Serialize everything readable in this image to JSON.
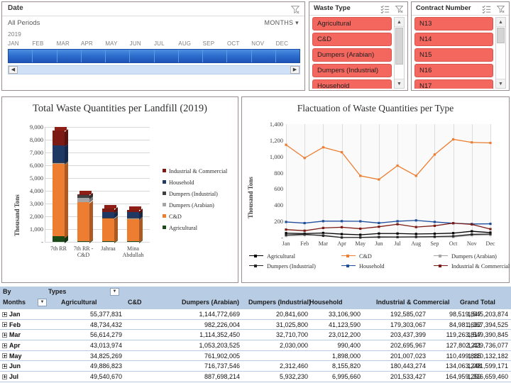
{
  "date_slicer": {
    "title": "Date",
    "period_label": "All Periods",
    "level": "MONTHS",
    "year": "2019",
    "months": [
      "JAN",
      "FEB",
      "MAR",
      "APR",
      "MAY",
      "JUN",
      "JUL",
      "AUG",
      "SEP",
      "OCT",
      "NOV",
      "DEC"
    ],
    "clear_filter_icon": "clear-filter-icon",
    "selection_color": "#2f6fcf"
  },
  "waste_type_slicer": {
    "title": "Waste Type",
    "multi_select_icon": "multi-select-icon",
    "clear_filter_icon": "clear-filter-icon",
    "selected_color": "#f4675f",
    "items": [
      "Agricultural",
      "C&D",
      "Dumpers (Arabian)",
      "Dumpers (Industrial)",
      "Household"
    ]
  },
  "contract_number_slicer": {
    "title": "Contract Number",
    "multi_select_icon": "multi-select-icon",
    "clear_filter_icon": "clear-filter-icon",
    "selected_color": "#f4675f",
    "items": [
      "N13",
      "N14",
      "N15",
      "N16",
      "N17"
    ]
  },
  "chart_data": [
    {
      "type": "bar",
      "id": "bar",
      "title": "Total Waste Quantities per Landfill (2019)",
      "xlabel": "",
      "ylabel": "Thousand Tons",
      "ylim": [
        0,
        9000
      ],
      "yticks": [
        "-",
        "1,000",
        "2,000",
        "3,000",
        "4,000",
        "5,000",
        "6,000",
        "7,000",
        "8,000",
        "9,000"
      ],
      "grid": true,
      "stacked": true,
      "legend_position": "right",
      "categories": [
        "7th RR",
        "7th RR - C&D",
        "Jahraa",
        "Mina Abdullah"
      ],
      "series": [
        {
          "name": "Agricultural",
          "color": "#1b4a18",
          "values": [
            430,
            40,
            45,
            40
          ]
        },
        {
          "name": "C&D",
          "color": "#ed7d31",
          "values": [
            5700,
            3080,
            1820,
            1800
          ]
        },
        {
          "name": "Dumpers (Arabian)",
          "color": "#a5a5a5",
          "values": [
            60,
            300,
            20,
            20
          ]
        },
        {
          "name": "Dumpers (Industrial)",
          "color": "#404040",
          "values": [
            40,
            280,
            20,
            20
          ]
        },
        {
          "name": "Household",
          "color": "#1f3864",
          "values": [
            1330,
            30,
            410,
            430
          ]
        },
        {
          "name": "Industrial & Commercial",
          "color": "#7b1b13",
          "values": [
            1140,
            20,
            290,
            200
          ]
        }
      ]
    },
    {
      "type": "line",
      "id": "line",
      "title": "Flactuation of Waste Quantities per Type",
      "xlabel": "",
      "ylabel": "Thousand Tons",
      "ylim": [
        0,
        1400
      ],
      "yticks": [
        "-",
        "200",
        "400",
        "600",
        "800",
        "1,000",
        "1,200",
        "1,400"
      ],
      "grid": true,
      "legend_position": "bottom",
      "categories": [
        "Jan",
        "Feb",
        "Mar",
        "Apr",
        "May",
        "Jun",
        "Jul",
        "Aug",
        "Sep",
        "Oct",
        "Nov",
        "Dec"
      ],
      "series": [
        {
          "name": "Agricultural",
          "color": "#000000",
          "values": [
            55,
            49,
            57,
            43,
            35,
            50,
            50,
            45,
            48,
            55,
            78,
            62
          ]
        },
        {
          "name": "C&D",
          "color": "#ed7d31",
          "values": [
            1145,
            982,
            1114,
            1053,
            762,
            717,
            888,
            762,
            1025,
            1212,
            1175,
            1168
          ]
        },
        {
          "name": "Dumpers (Arabian)",
          "color": "#a5a5a5",
          "values": [
            21,
            31,
            33,
            2,
            0,
            2,
            6,
            4,
            6,
            8,
            30,
            34
          ]
        },
        {
          "name": "Dumpers (Industrial)",
          "color": "#262626",
          "values": [
            33,
            41,
            23,
            1,
            2,
            8,
            7,
            10,
            12,
            18,
            40,
            44
          ]
        },
        {
          "name": "Household",
          "color": "#1f4e9c",
          "values": [
            193,
            179,
            203,
            203,
            201,
            180,
            202,
            212,
            193,
            177,
            168,
            170
          ]
        },
        {
          "name": "Industrial & Commercial",
          "color": "#7b1b13",
          "values": [
            99,
            85,
            119,
            128,
            110,
            134,
            165,
            130,
            146,
            178,
            163,
            105
          ]
        }
      ]
    }
  ],
  "pivot_table": {
    "corner_top": "By",
    "corner_bottom": "Months",
    "types_label": "Types",
    "types_dropdown_icon": "dropdown-arrow-icon",
    "months_dropdown_icon": "dropdown-arrow-icon",
    "columns": [
      "Agricultural",
      "C&D",
      "Dumpers (Arabian)",
      "Dumpers (Industrial)",
      "Household",
      "Industrial & Commercial",
      "Grand Total"
    ],
    "rows": [
      {
        "month": "Jan",
        "expand_icon": "expand-plus-icon",
        "values": [
          "55,377,831",
          "1,144,772,669",
          "20,841,600",
          "33,106,900",
          "192,585,027",
          "98,519,847",
          "1,545,203,874"
        ]
      },
      {
        "month": "Feb",
        "expand_icon": "expand-plus-icon",
        "values": [
          "48,734,432",
          "982,226,004",
          "31,025,800",
          "41,123,590",
          "179,303,067",
          "84,981,632",
          "1,367,394,525"
        ]
      },
      {
        "month": "Mar",
        "expand_icon": "expand-plus-icon",
        "values": [
          "56,614,279",
          "1,114,352,450",
          "32,710,700",
          "23,012,200",
          "203,437,399",
          "119,263,817",
          "1,549,390,845"
        ]
      },
      {
        "month": "Apr",
        "expand_icon": "expand-plus-icon",
        "values": [
          "43,013,974",
          "1,053,203,525",
          "2,030,000",
          "990,400",
          "202,695,967",
          "127,802,211",
          "1,429,736,077"
        ]
      },
      {
        "month": "May",
        "expand_icon": "expand-plus-icon",
        "values": [
          "34,825,269",
          "761,902,005",
          "",
          "1,898,000",
          "201,007,023",
          "110,499,885",
          "1,110,132,182"
        ]
      },
      {
        "month": "Jun",
        "expand_icon": "expand-plus-icon",
        "values": [
          "49,886,823",
          "716,737,546",
          "2,312,460",
          "8,155,820",
          "180,443,274",
          "134,063,248",
          "1,091,599,171"
        ]
      },
      {
        "month": "Jul",
        "expand_icon": "expand-plus-icon",
        "values": [
          "49,540,670",
          "887,698,214",
          "5,932,230",
          "6,995,660",
          "201,533,427",
          "164,959,259",
          "1,316,659,460"
        ]
      }
    ],
    "header_color": "#b8cce4"
  }
}
